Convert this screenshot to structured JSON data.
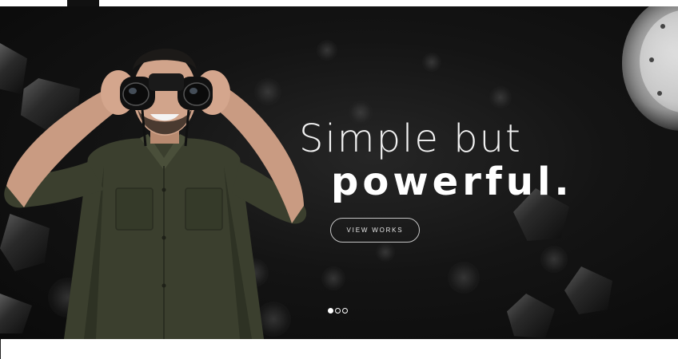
{
  "hero": {
    "headline_light": "Simple but",
    "headline_bold": "powerful.",
    "cta_label": "VIEW WORKS",
    "slides": [
      {
        "active": true
      },
      {
        "active": false
      },
      {
        "active": false
      }
    ]
  },
  "colors": {
    "background": "#141414",
    "text": "#ffffff",
    "shirt": "#3b3f2e"
  },
  "icons": {
    "slider_dot": "circle"
  }
}
